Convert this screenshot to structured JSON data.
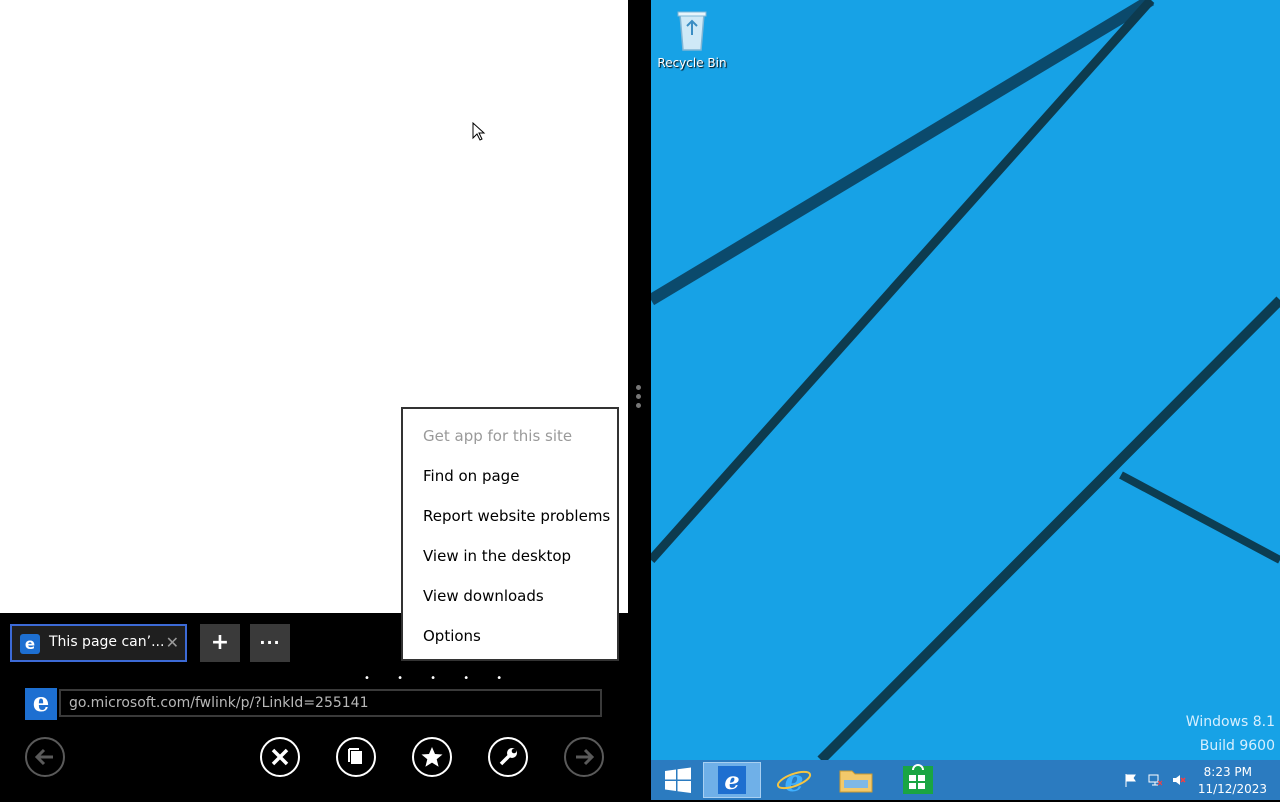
{
  "browser": {
    "tab": {
      "title": "This page can’...",
      "close_glyph": "✕"
    },
    "new_tab_glyph": "+",
    "tab_menu_glyph": "···",
    "page_dots": "• • • • •",
    "address": {
      "url": "go.microsoft.com/fwlink/p/?LinkId=255141"
    },
    "nav": {
      "back": "back-arrow-icon",
      "stop": "stop-icon",
      "tabs": "tabs-icon",
      "favorites": "favorites-star-icon",
      "tools": "page-tools-wrench-icon",
      "forward": "forward-arrow-icon"
    }
  },
  "page_tools_menu": {
    "items": [
      {
        "label": "Get app for this site",
        "enabled": false
      },
      {
        "label": "Find on page",
        "enabled": true
      },
      {
        "label": "Report website problems",
        "enabled": true
      },
      {
        "label": "View in the desktop",
        "enabled": true
      },
      {
        "label": "View downloads",
        "enabled": true
      },
      {
        "label": "Options",
        "enabled": true
      }
    ]
  },
  "desktop": {
    "recycle_bin_label": "Recycle Bin",
    "watermark_line1": "Windows 8.1",
    "watermark_line2": "Build 9600",
    "background_color": "#17a2e6"
  },
  "taskbar": {
    "pinned": [
      "windows-start-icon",
      "internet-explorer-modern-icon",
      "internet-explorer-icon",
      "file-explorer-icon",
      "store-icon"
    ],
    "clock_time": "8:23 PM",
    "clock_date": "11/12/2023",
    "tray": [
      "action-center-flag-icon",
      "network-icon",
      "volume-muted-icon"
    ]
  }
}
